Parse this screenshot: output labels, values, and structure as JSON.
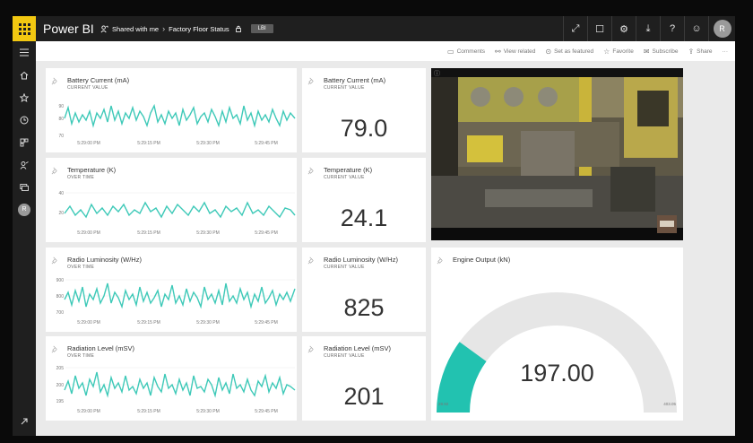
{
  "app": {
    "title": "Power BI",
    "breadcrumb": {
      "shared": "Shared with me",
      "dashboard": "Factory Floor Status",
      "badge": "LBI"
    }
  },
  "top_actions": [
    {
      "name": "fullscreen-icon",
      "glyph": "⤢"
    },
    {
      "name": "comment-icon",
      "glyph": "☐"
    },
    {
      "name": "settings-icon",
      "glyph": "⚙"
    },
    {
      "name": "download-icon",
      "glyph": "⤓"
    },
    {
      "name": "help-icon",
      "glyph": "?"
    },
    {
      "name": "feedback-icon",
      "glyph": "☺"
    }
  ],
  "user_initial": "R",
  "actions": {
    "comments": "Comments",
    "view_related": "View related",
    "set_featured": "Set as featured",
    "favorite": "Favorite",
    "subscribe": "Subscribe",
    "share": "Share",
    "more": "···"
  },
  "colors": {
    "accent": "#f2c811",
    "line": "#3ec9b8",
    "gauge_fill": "#22c2b0",
    "gauge_track": "#e6e6e6"
  },
  "tiles": {
    "battery_chart": {
      "title": "Battery Current (mA)",
      "subtitle": "CURRENT VALUE",
      "y_ticks": [
        "90",
        "80",
        "70"
      ],
      "x_ticks": [
        "5:29:00 PM",
        "5:29:15 PM",
        "5:29:30 PM",
        "5:29:45 PM"
      ]
    },
    "battery_card": {
      "title": "Battery Current (mA)",
      "subtitle": "CURRENT VALUE",
      "value": "79.0"
    },
    "temperature_chart": {
      "title": "Temperature (K)",
      "subtitle": "OVER TIME",
      "y_ticks": [
        "40",
        "20"
      ],
      "x_ticks": [
        "5:29:00 PM",
        "5:29:15 PM",
        "5:29:30 PM",
        "5:29:45 PM"
      ]
    },
    "temperature_card": {
      "title": "Temperature (K)",
      "subtitle": "CURRENT VALUE",
      "value": "24.1"
    },
    "luminosity_chart": {
      "title": "Radio Luminosity (W/Hz)",
      "subtitle": "OVER TIME",
      "y_ticks": [
        "900",
        "800",
        "700"
      ],
      "x_ticks": [
        "5:29:00 PM",
        "5:29:15 PM",
        "5:29:30 PM",
        "5:29:45 PM"
      ]
    },
    "luminosity_card": {
      "title": "Radio Luminosity (W/Hz)",
      "subtitle": "CURRENT VALUE",
      "value": "825"
    },
    "radiation_chart": {
      "title": "Radiation Level (mSV)",
      "subtitle": "OVER TIME",
      "y_ticks": [
        "205",
        "200",
        "195"
      ],
      "x_ticks": [
        "5:29:00 PM",
        "5:29:15 PM",
        "5:29:30 PM",
        "5:29:45 PM"
      ]
    },
    "radiation_card": {
      "title": "Radiation Level (mSV)",
      "subtitle": "CURRENT VALUE",
      "value": "201"
    },
    "engine_gauge": {
      "title": "Engine Output (kN)",
      "value": "197.00",
      "min_label": "28.92",
      "max_label": "403.05",
      "fill_fraction": 0.2
    }
  }
}
